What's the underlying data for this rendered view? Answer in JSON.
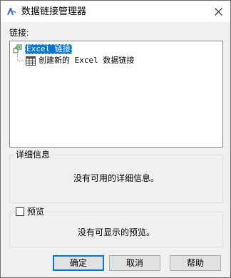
{
  "window": {
    "title": "数据链接管理器",
    "app_icon": "autocad-icon",
    "close_icon": "close-icon"
  },
  "links_label": "链接:",
  "tree": {
    "root_label": "Excel 链接",
    "root_icon": "excel-link-icon",
    "child_label": "创建新的 Excel 数据链接",
    "child_icon": "table-grid-icon"
  },
  "details": {
    "title": "详细信息",
    "message": "没有可用的详细信息。"
  },
  "preview": {
    "checkbox_label": "预览",
    "checked": false,
    "message": "没有可显示的预览。"
  },
  "buttons": {
    "ok": "确定",
    "cancel": "取消",
    "help": "帮助"
  },
  "colors": {
    "selection": "#0078d7",
    "dialog_bg": "#f0f0f0",
    "button_bg": "#e1e1e1"
  }
}
